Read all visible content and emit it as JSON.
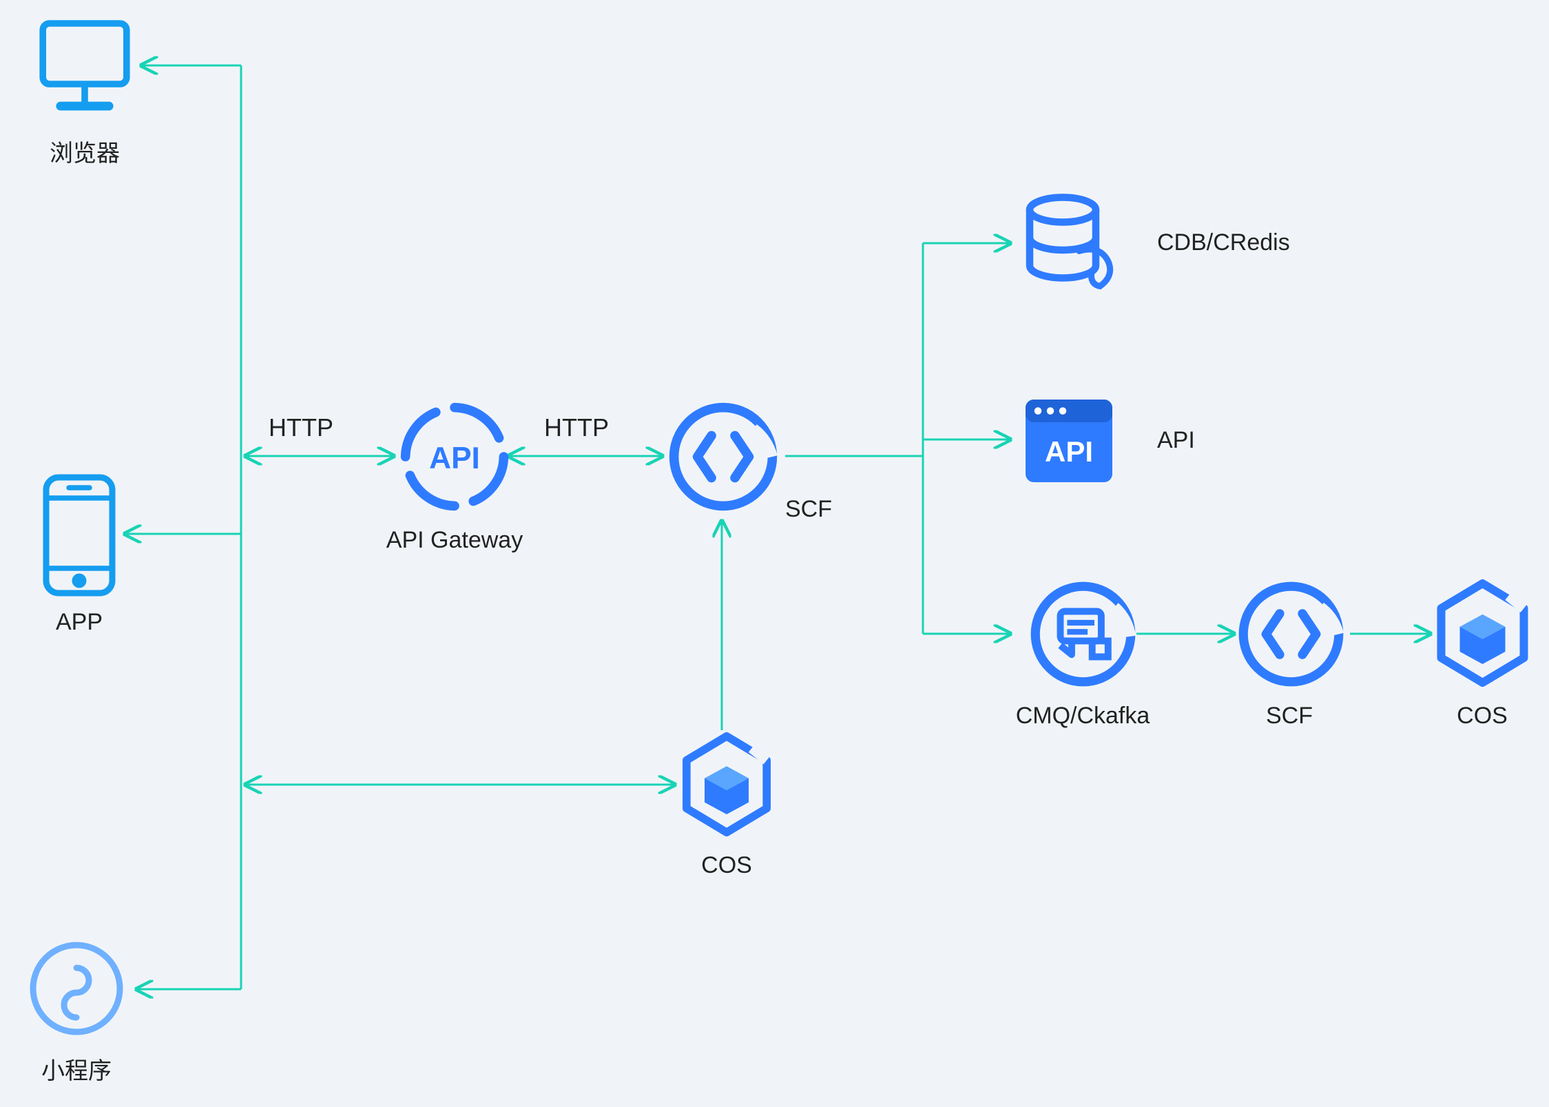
{
  "nodes": {
    "browser": {
      "label": "浏览器"
    },
    "app": {
      "label": "APP"
    },
    "miniprogram": {
      "label": "小程序"
    },
    "api_gateway": {
      "label": "API Gateway"
    },
    "scf_main": {
      "label": "SCF"
    },
    "cos_main": {
      "label": "COS"
    },
    "cdb": {
      "label": "CDB/CRedis"
    },
    "api_service": {
      "label": "API"
    },
    "cmq": {
      "label": "CMQ/Ckafka"
    },
    "scf2": {
      "label": "SCF"
    },
    "cos2": {
      "label": "COS"
    }
  },
  "edges": {
    "http1": {
      "label": "HTTP"
    },
    "http2": {
      "label": "HTTP"
    }
  },
  "colors": {
    "arrow": "#19d3b5",
    "iconPrimary": "#2f7bff",
    "iconLight": "#5aa6ff"
  }
}
